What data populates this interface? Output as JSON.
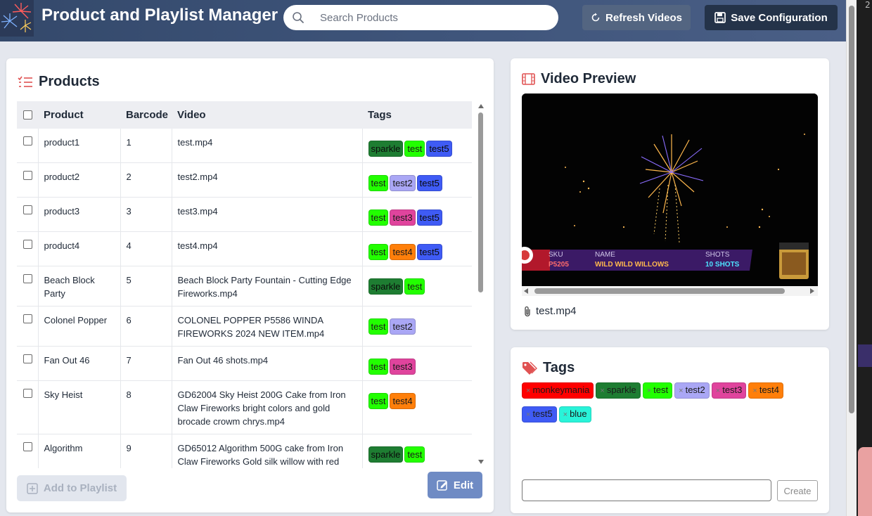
{
  "header": {
    "title": "Product and Playlist Manager",
    "search_placeholder": "Search Products",
    "refresh_label": "Refresh Videos",
    "save_label": "Save Configuration"
  },
  "products": {
    "title": "Products",
    "columns": [
      "Product",
      "Barcode",
      "Video",
      "Tags"
    ],
    "rows": [
      {
        "product": "product1",
        "barcode": "1",
        "video": "test.mp4",
        "tags": [
          "sparkle",
          "test",
          "test5"
        ]
      },
      {
        "product": "product2",
        "barcode": "2",
        "video": "test2.mp4",
        "tags": [
          "test",
          "test2",
          "test5"
        ]
      },
      {
        "product": "product3",
        "barcode": "3",
        "video": "test3.mp4",
        "tags": [
          "test",
          "test3",
          "test5"
        ]
      },
      {
        "product": "product4",
        "barcode": "4",
        "video": "test4.mp4",
        "tags": [
          "test",
          "test4",
          "test5"
        ]
      },
      {
        "product": "Beach Block Party",
        "barcode": "5",
        "video": "Beach Block Party Fountain - Cutting Edge Fireworks.mp4",
        "tags": [
          "sparkle",
          "test"
        ]
      },
      {
        "product": "Colonel Popper",
        "barcode": "6",
        "video": "COLONEL POPPER P5586 WINDA FIREWORKS 2024 NEW ITEM.mp4",
        "tags": [
          "test",
          "test2"
        ]
      },
      {
        "product": "Fan Out 46",
        "barcode": "7",
        "video": "Fan Out 46 shots.mp4",
        "tags": [
          "test",
          "test3"
        ]
      },
      {
        "product": "Sky Heist",
        "barcode": "8",
        "video": "GD62004 Sky Heist 200G Cake from Iron Claw Fireworks bright colors and gold brocade crowm chrys.mp4",
        "tags": [
          "test",
          "test4"
        ]
      },
      {
        "product": "Algorithm",
        "barcode": "9",
        "video": "GD65012 Algorithm 500G cake from Iron Claw Fireworks Gold silk willow with red",
        "tags": [
          "sparkle",
          "test"
        ]
      }
    ],
    "add_label": "Add to Playlist",
    "edit_label": "Edit"
  },
  "video": {
    "title": "Video Preview",
    "filename": "test.mp4",
    "overlay": {
      "sku_label": "SKU",
      "sku_value": "P5205",
      "name_label": "NAME",
      "name_value": "WILD WILD WILLOWS",
      "shots_label": "SHOTS",
      "shots_value": "10 SHOTS"
    }
  },
  "tags_panel": {
    "title": "Tags",
    "tags": [
      "monkeymania",
      "sparkle",
      "test",
      "test2",
      "test3",
      "test4",
      "test5",
      "blue"
    ],
    "remove_glyph": "×",
    "create_label": "Create"
  },
  "tag_colors": {
    "monkeymania": "#ff0000",
    "sparkle": "#1e7d32",
    "test": "#22ff00",
    "test2": "#aaa7f5",
    "test3": "#e0449d",
    "test4": "#ff7f0a",
    "test5": "#3f5bf5",
    "blue": "#29f3d9"
  },
  "edge": {
    "char": "2"
  }
}
